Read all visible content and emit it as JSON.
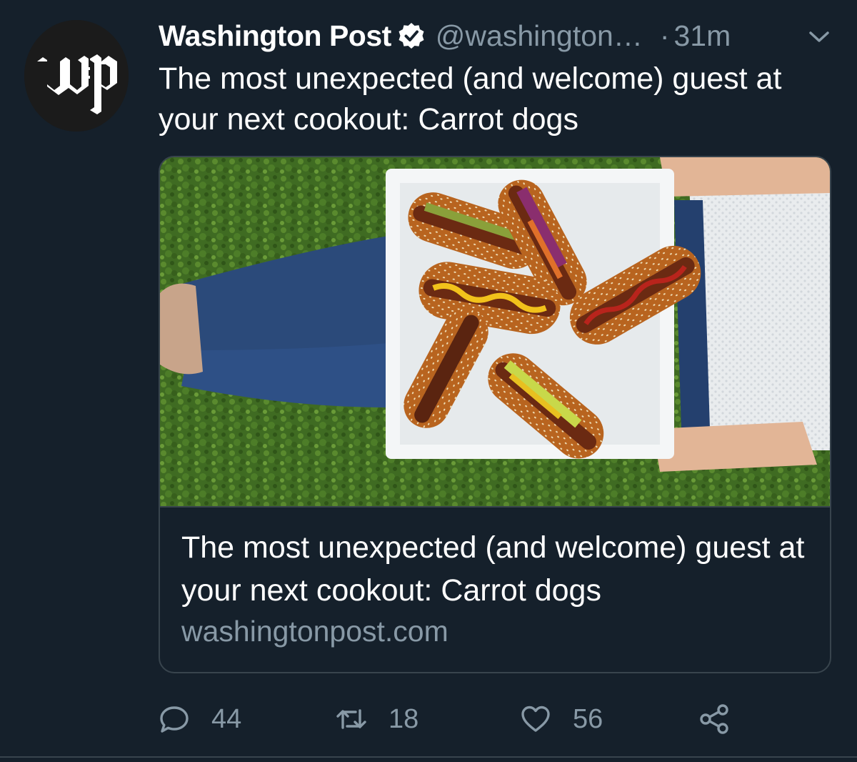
{
  "tweet": {
    "author": {
      "display_name": "Washington Post",
      "handle": "@washington…",
      "verified": true,
      "avatar_monogram": "wp"
    },
    "separator": "·",
    "timestamp": "31m",
    "text": "The most unexpected (and welcome) guest at your next cookout: Carrot dogs",
    "card": {
      "title": "The most unexpected (and welcome) guest at your next cookout: Carrot dogs",
      "domain": "washingtonpost.com"
    },
    "actions": {
      "reply_count": "44",
      "retweet_count": "18",
      "like_count": "56"
    }
  },
  "icons": {
    "verified": "verified-badge-icon",
    "caret": "chevron-down-icon",
    "reply": "reply-bubble-icon",
    "retweet": "retweet-icon",
    "like": "heart-icon",
    "share": "share-icon"
  },
  "colors": {
    "background": "#15202b",
    "border": "#38444d",
    "secondary_text": "#8899a6",
    "primary_text": "#ffffff"
  }
}
